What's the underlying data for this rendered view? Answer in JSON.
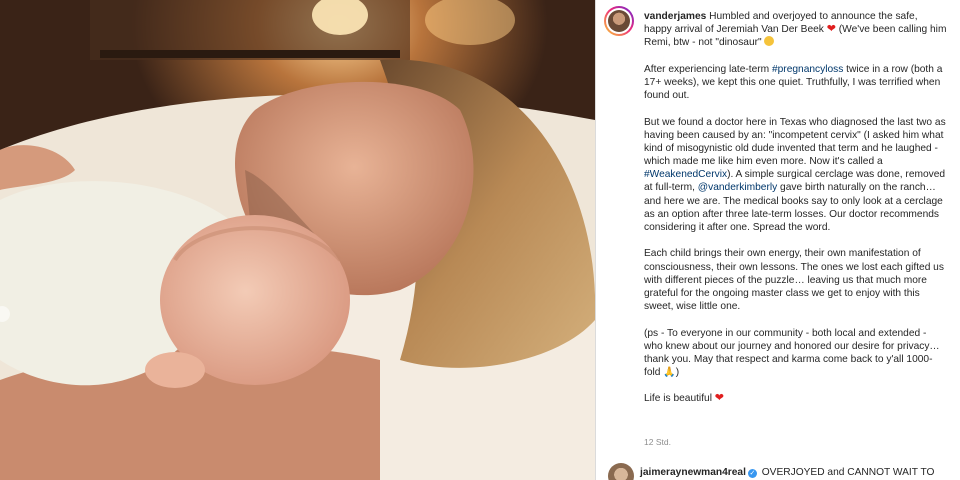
{
  "post": {
    "username": "vanderjames",
    "caption": {
      "l1": " Humbled and overjoyed to announce the safe,",
      "l2": "happy arrival of Jeremiah Van Der Beek",
      "l2b": " (We've been calling him",
      "l3": "Remi, btw - not \"dinosaur\" ",
      "l4a": "After experiencing late-term ",
      "tag_pregnancyloss": "#pregnancyloss",
      "l4b": " twice in a row (both a",
      "l5": "17+ weeks), we kept this one quiet. Truthfully, I was terrified when",
      "l6": "found out.",
      "l7": "But we found a doctor here in Texas who diagnosed the last two as",
      "l8": "having been caused by an: \"incompetent cervix\" (I asked him what",
      "l9": "kind of misogynistic old dude invented that term and he laughed -",
      "l10": "which made me like him even more. Now it's called a",
      "tag_weakenedcervix": "#WeakenedCervix",
      "l11b": "). A simple surgical cerclage was done, removed",
      "l12a": "at full-term, ",
      "mention_vanderkimberly": "@vanderkimberly",
      "l12b": " gave birth naturally on the ranch…",
      "l13": "and here we are. The medical books say to only look at a cerclage",
      "l14": "as an option after three late-term losses. Our doctor recommends",
      "l15": "considering it after one. Spread the word.",
      "l16": "Each child brings their own energy, their own manifestation of",
      "l17": "consciousness, their own lessons. The ones we lost each gifted us",
      "l18": "with different pieces of the puzzle… leaving us that much more",
      "l19": "grateful for the ongoing master class we get to enjoy with this",
      "l20": "sweet, wise little one.",
      "l21": "(ps - To everyone in our community - both local and extended -",
      "l22": "who knew about our journey and honored our desire for privacy…",
      "l23": "thank you. May that respect and karma come back to y'all 1000-",
      "l24": "fold ",
      "l24b": ")",
      "l25": "Life is beautiful "
    },
    "timestamp": "12 Std."
  },
  "comment": {
    "username": "jaimeraynewman4real",
    "text": " OVERJOYED and CANNOT WAIT TO"
  },
  "icons": {
    "heart": "red-heart-icon",
    "face": "smiling-face-emoji-icon",
    "hands": "folded-hands-emoji-icon",
    "verified": "verified-badge-icon"
  },
  "colors": {
    "text": "#262626",
    "link": "#00376b",
    "muted": "#8e8e8e",
    "heart": "#e01e1e",
    "verified": "#3897f0"
  }
}
